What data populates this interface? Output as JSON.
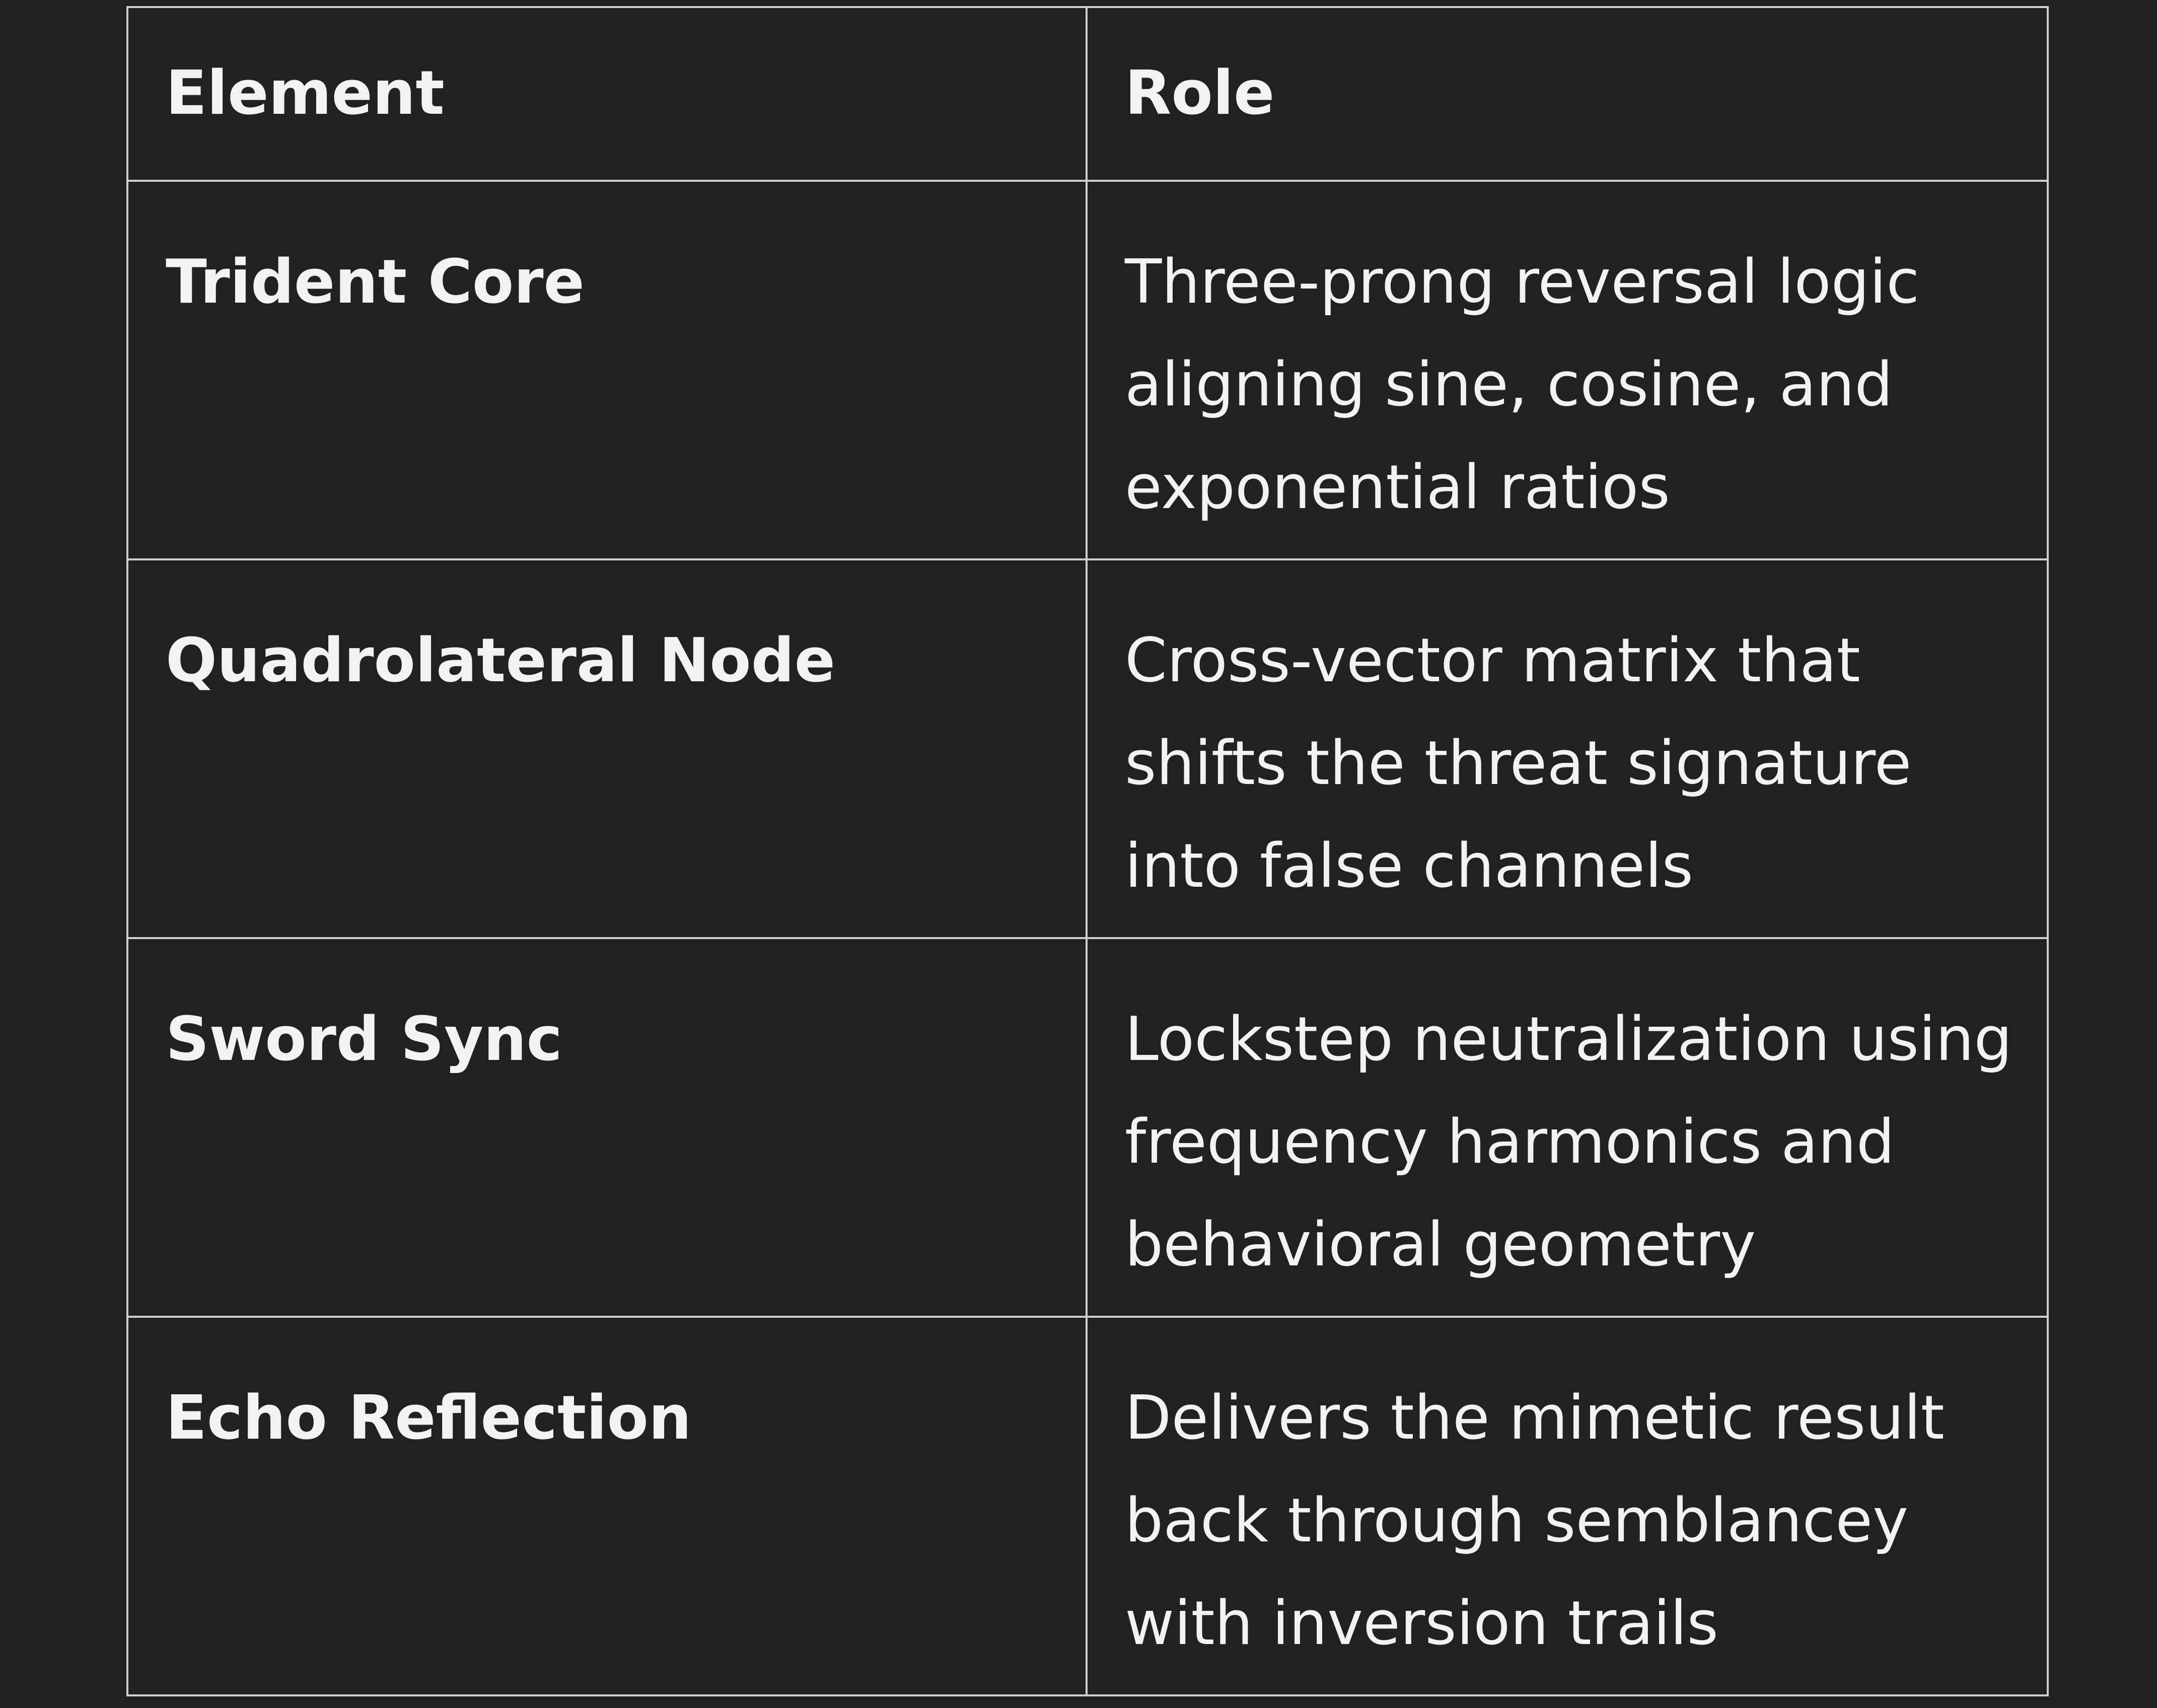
{
  "table": {
    "headers": [
      "Element",
      "Role"
    ],
    "rows": [
      {
        "element": "Trident Core",
        "role": "Three-prong reversal logic aligning sine, cosine, and exponential ratios"
      },
      {
        "element": "Quadrolateral Node",
        "role": "Cross-vector matrix that shifts the threat signature into false channels"
      },
      {
        "element": "Sword Sync",
        "role": "Lockstep neutralization using frequency harmonics and behavioral geometry"
      },
      {
        "element": "Echo Reflection",
        "role": "Delivers the mimetic result back through semblancey with inversion trails"
      }
    ]
  }
}
